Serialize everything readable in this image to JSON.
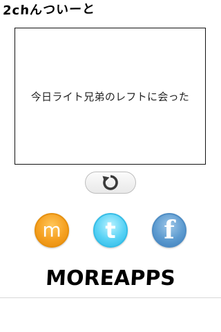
{
  "header": {
    "title": "2chんついーと"
  },
  "tweet": {
    "text": "今日ライト兄弟のレフトに会った"
  },
  "refresh_button": {
    "icon": "refresh-icon"
  },
  "share": {
    "mixi": {
      "label": "m",
      "icon": "mixi-icon",
      "color": "#f5a020"
    },
    "twitter": {
      "label": "t",
      "icon": "twitter-icon",
      "color": "#58d2f5"
    },
    "facebook": {
      "label": "f",
      "icon": "facebook-icon",
      "color": "#5d9bd0"
    }
  },
  "more_apps": {
    "label": "MOREAPPS"
  }
}
